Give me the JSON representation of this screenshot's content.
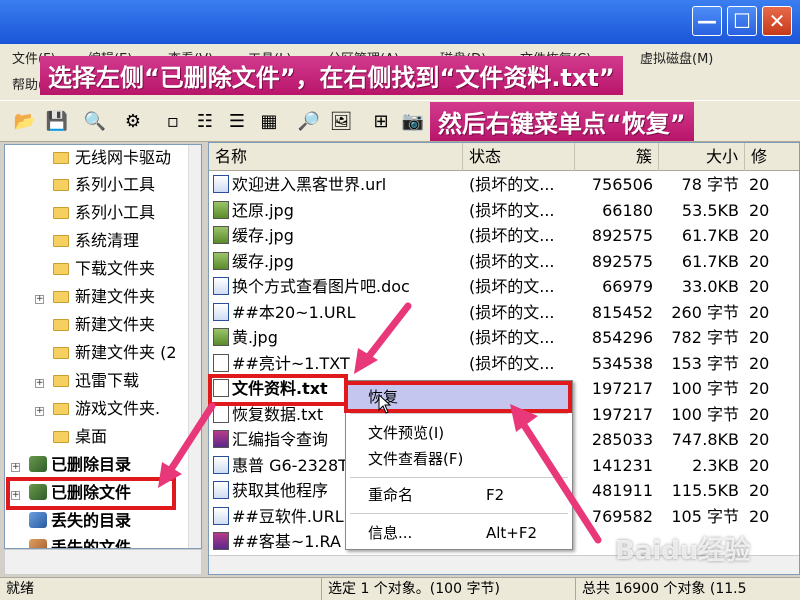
{
  "window": {
    "minimize_glyph": "—",
    "maximize_glyph": "☐",
    "close_glyph": "✕"
  },
  "menubar": {
    "items": [
      "文件(F)",
      "编辑(E)",
      "查看(V)",
      "工具(L)",
      "分区管理(A)",
      "磁盘(D)",
      "文件恢复(C)",
      "虚拟磁盘(M)",
      "帮助(H)"
    ]
  },
  "overlay": {
    "line1": "选择左侧“已删除文件”，在右侧找到“文件资料.txt”",
    "line2": "然后右键菜单点“恢复”"
  },
  "tree": {
    "items": [
      {
        "label": "无线网卡驱动",
        "expandable": false
      },
      {
        "label": "系列小工具",
        "expandable": false
      },
      {
        "label": "系列小工具",
        "expandable": false
      },
      {
        "label": "系统清理",
        "expandable": false
      },
      {
        "label": "下载文件夹",
        "expandable": false
      },
      {
        "label": "新建文件夹",
        "expandable": true
      },
      {
        "label": "新建文件夹",
        "expandable": false
      },
      {
        "label": "新建文件夹 (2",
        "expandable": false
      },
      {
        "label": "迅雷下载",
        "expandable": true
      },
      {
        "label": "游戏文件夹.",
        "expandable": true
      },
      {
        "label": "桌面",
        "expandable": false
      }
    ],
    "special": [
      {
        "label": "已删除目录"
      },
      {
        "label": "已删除文件"
      },
      {
        "label": "丢失的目录"
      },
      {
        "label": "丢失的文件"
      }
    ]
  },
  "list": {
    "columns": [
      "名称",
      "状态",
      "簇",
      "大小",
      "修"
    ],
    "rows": [
      {
        "name": "欢迎进入黑客世界.url",
        "status": "(损坏的文...",
        "cluster": "756506",
        "size": "78 字节",
        "mod": "20",
        "type": "doc"
      },
      {
        "name": "还原.jpg",
        "status": "(损坏的文...",
        "cluster": "66180",
        "size": "53.5KB",
        "mod": "20",
        "type": "jpg"
      },
      {
        "name": "缓存.jpg",
        "status": "(损坏的文...",
        "cluster": "892575",
        "size": "61.7KB",
        "mod": "20",
        "type": "jpg"
      },
      {
        "name": "缓存.jpg",
        "status": "(损坏的文...",
        "cluster": "892575",
        "size": "61.7KB",
        "mod": "20",
        "type": "jpg"
      },
      {
        "name": "换个方式查看图片吧.doc",
        "status": "(损坏的文...",
        "cluster": "66979",
        "size": "33.0KB",
        "mod": "20",
        "type": "doc"
      },
      {
        "name": "##本20~1.URL",
        "status": "(损坏的文...",
        "cluster": "815452",
        "size": "260 字节",
        "mod": "20",
        "type": "doc"
      },
      {
        "name": "黄.jpg",
        "status": "(损坏的文...",
        "cluster": "854296",
        "size": "782 字节",
        "mod": "20",
        "type": "jpg"
      },
      {
        "name": "##亮计~1.TXT",
        "status": "(损坏的文...",
        "cluster": "534538",
        "size": "153 字节",
        "mod": "20",
        "type": "txt"
      },
      {
        "name": "文件资料.txt",
        "status": "",
        "cluster": "197217",
        "size": "100 字节",
        "mod": "20",
        "type": "txt"
      },
      {
        "name": "恢复数据.txt",
        "status": "",
        "cluster": "197217",
        "size": "100 字节",
        "mod": "20",
        "type": "txt"
      },
      {
        "name": "汇编指令查询",
        "status": "",
        "cluster": "285033",
        "size": "747.8KB",
        "mod": "20",
        "type": "rar"
      },
      {
        "name": "惠普 G6-2328T",
        "status": "",
        "cluster": "141231",
        "size": "2.3KB",
        "mod": "20",
        "type": "doc"
      },
      {
        "name": "获取其他程序",
        "status": "",
        "cluster": "481911",
        "size": "115.5KB",
        "mod": "20",
        "type": "doc"
      },
      {
        "name": "##豆软件.URL",
        "status": "",
        "cluster": "769582",
        "size": "105 字节",
        "mod": "20",
        "type": "doc"
      },
      {
        "name": "##客基~1.RA",
        "status": "",
        "cluster": "",
        "size": "",
        "mod": "",
        "type": "rar"
      }
    ]
  },
  "context_menu": {
    "items": [
      {
        "label": "恢复",
        "accel": "",
        "highlighted": true
      },
      {
        "label": "文件预览(I)",
        "accel": "",
        "highlighted": false
      },
      {
        "label": "文件查看器(F)",
        "accel": "",
        "highlighted": false
      },
      {
        "label": "重命名",
        "accel": "F2",
        "highlighted": false
      },
      {
        "label": "信息...",
        "accel": "Alt+F2",
        "highlighted": false
      }
    ]
  },
  "statusbar": {
    "ready": "就绪",
    "selected": "选定 1 个对象。(100 字节)",
    "total": "总共 16900 个对象 (11.5"
  },
  "watermark": "Baidu经验"
}
